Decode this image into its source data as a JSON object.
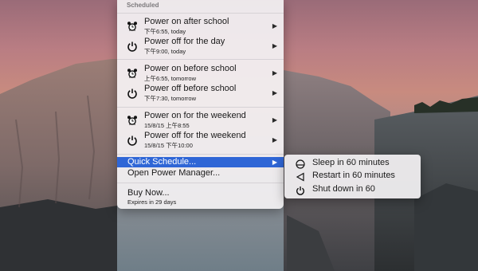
{
  "menu": {
    "header": "Scheduled",
    "schedules": [
      {
        "title": "Power on after school",
        "subtitle": "下午6:55, today",
        "icon": "alarm-clock-icon"
      },
      {
        "title": "Power off for the day",
        "subtitle": "下午9:00, today",
        "icon": "power-icon"
      },
      {
        "title": "Power on before school",
        "subtitle": "上午6:55, tomorrow",
        "icon": "alarm-clock-icon"
      },
      {
        "title": "Power off before school",
        "subtitle": "下午7:30, tomorrow",
        "icon": "power-icon"
      },
      {
        "title": "Power on for the weekend",
        "subtitle": "15/8/15 上午8:55",
        "icon": "alarm-clock-icon"
      },
      {
        "title": "Power off for the weekend",
        "subtitle": "15/8/15 下午10:00",
        "icon": "power-icon"
      }
    ],
    "quick_schedule": "Quick Schedule...",
    "open_power_manager": "Open Power Manager...",
    "buy_now": "Buy Now...",
    "expires": "Expires in 29 days",
    "highlight_color": "#2f66d6"
  },
  "submenu": {
    "items": [
      {
        "label": "Sleep in 60 minutes",
        "icon": "sleep-icon"
      },
      {
        "label": "Restart in 60 minutes",
        "icon": "restart-icon"
      },
      {
        "label": "Shut down in 60",
        "icon": "power-icon"
      }
    ]
  }
}
